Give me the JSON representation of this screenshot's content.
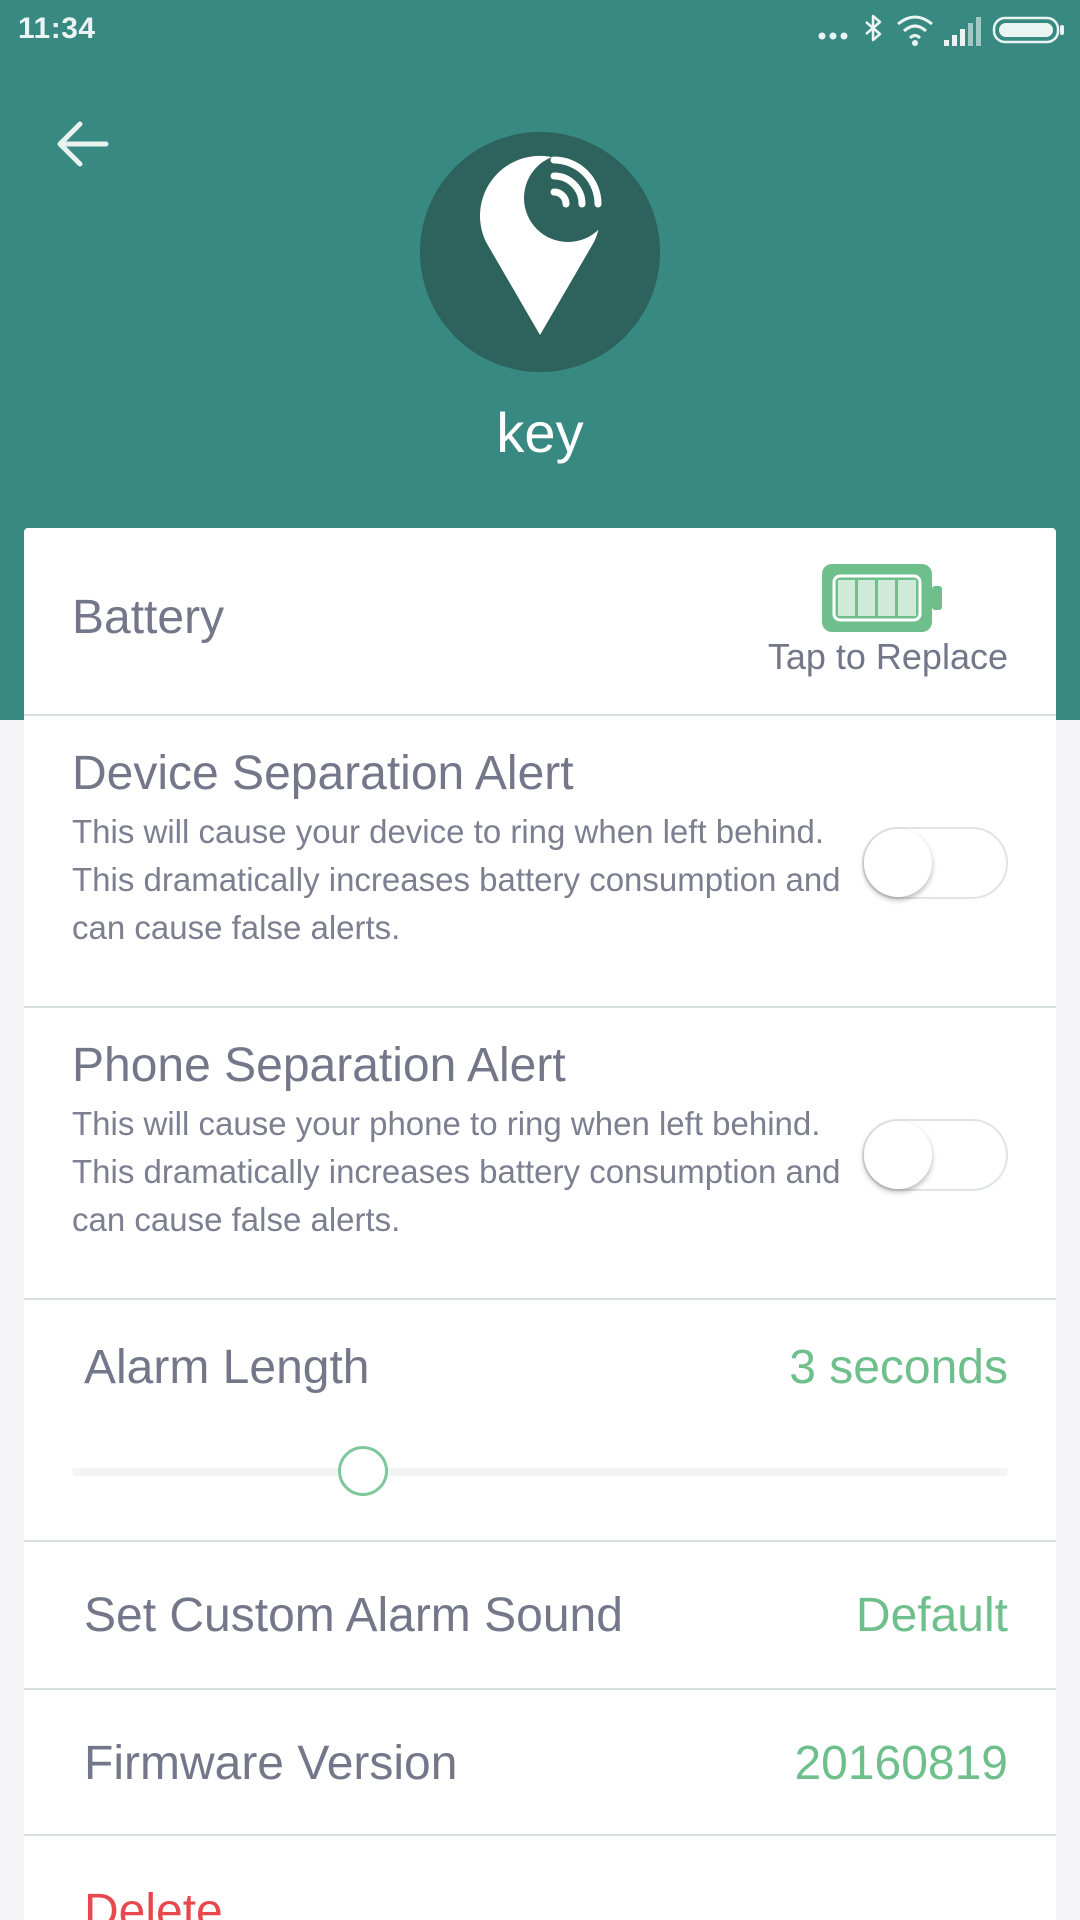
{
  "status_bar": {
    "time": "11:34",
    "icons": [
      "more-dots-icon",
      "bluetooth-icon",
      "wifi-icon",
      "signal-icon",
      "battery-status-icon"
    ]
  },
  "header": {
    "device_name": "key",
    "device_icon": "location-pin-signal-icon",
    "back_icon": "back-arrow-icon",
    "background_color": "#388981",
    "avatar_color": "#2d625d"
  },
  "battery": {
    "label": "Battery",
    "caption": "Tap to Replace",
    "level_segments_filled": 4,
    "level_segments_total": 4,
    "color": "#6fbf8c"
  },
  "device_separation_alert": {
    "title": "Device Separation Alert",
    "description": "This will cause your device to ring when left behind. This dramatically increases battery consumption and can cause false alerts.",
    "enabled": false
  },
  "phone_separation_alert": {
    "title": "Phone Separation Alert",
    "description": "This will cause your phone to ring when left behind. This dramatically increases battery consumption and can cause false alerts.",
    "enabled": false
  },
  "alarm_length": {
    "label": "Alarm Length",
    "value_text": "3 seconds",
    "slider_fraction": 0.31
  },
  "custom_alarm_sound": {
    "label": "Set Custom Alarm Sound",
    "value": "Default"
  },
  "firmware": {
    "label": "Firmware Version",
    "value": "20160819"
  },
  "delete": {
    "label": "Delete"
  },
  "colors": {
    "accent": "#6fbf8c",
    "danger": "#e8474d",
    "text": "#747789"
  }
}
